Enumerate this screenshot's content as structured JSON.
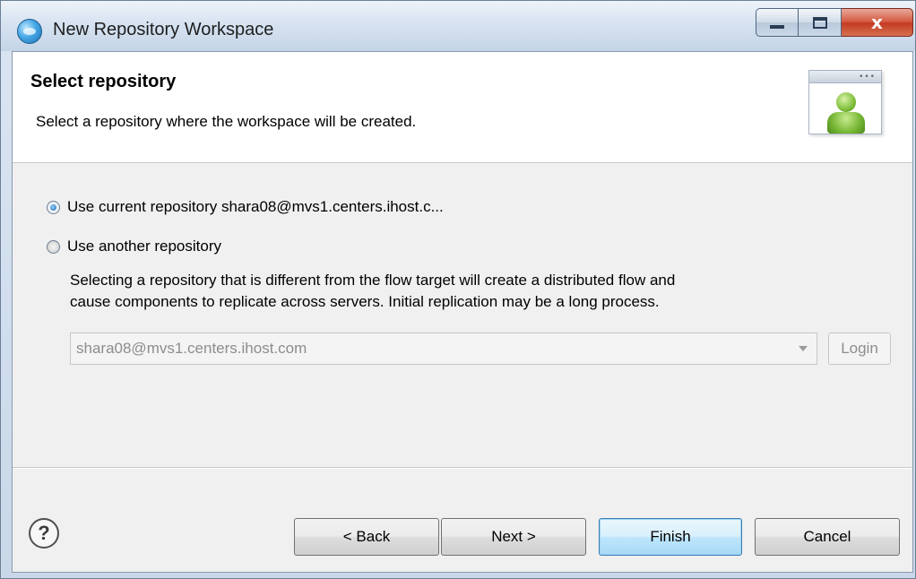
{
  "window": {
    "title": "New Repository Workspace",
    "app_icon": "eclipse-globe-icon",
    "controls": {
      "minimize": "minimize-icon",
      "maximize": "maximize-icon",
      "close": "x"
    }
  },
  "header": {
    "title": "Select repository",
    "subtitle": "Select a repository where the workspace will be created.",
    "banner_icon": "user-window-icon"
  },
  "options": {
    "current": {
      "label": "Use current repository shara08@mvs1.centers.ihost.c...",
      "selected": true
    },
    "another": {
      "label": "Use another repository",
      "selected": false
    }
  },
  "note": {
    "line1": "Selecting a repository that is different from the flow target will create a distributed flow and",
    "line2": "cause components to replicate across servers. Initial replication may be a long process."
  },
  "repository_select": {
    "value": "shara08@mvs1.centers.ihost.com",
    "enabled": false
  },
  "login_button": {
    "label": "Login",
    "enabled": false
  },
  "footer": {
    "help_icon": "?",
    "back": "< Back",
    "next": "Next >",
    "finish": "Finish",
    "cancel": "Cancel"
  },
  "colors": {
    "dialog_bg": "#f0f0f0",
    "header_bg": "#ffffff",
    "default_button_border": "#3c7fb1",
    "close_button": "#c33a22"
  }
}
